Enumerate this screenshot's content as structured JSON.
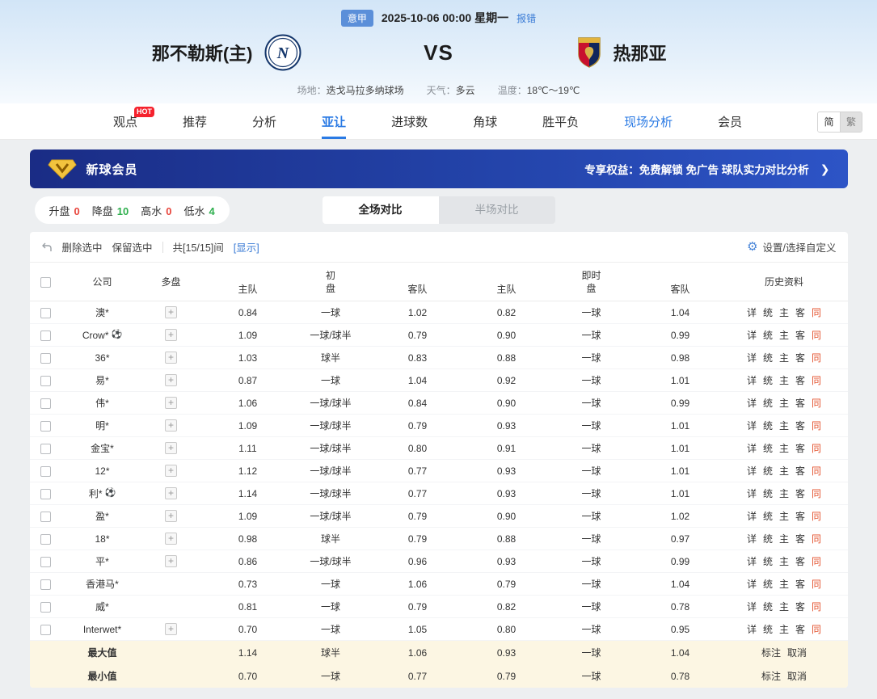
{
  "header": {
    "league_badge": "意甲",
    "datetime": "2025-10-06 00:00 星期一",
    "report_error": "报错",
    "home_team": "那不勒斯(主)",
    "home_logo_letter": "N",
    "vs": "VS",
    "away_team": "热那亚",
    "venue_label": "场地：",
    "venue": "迭戈马拉多纳球场",
    "weather_label": "天气：",
    "weather": "多云",
    "temp_label": "温度：",
    "temperature": "18℃～19℃"
  },
  "nav": {
    "items": [
      {
        "id": "viewpoint",
        "label": "观点",
        "badge": "HOT"
      },
      {
        "id": "recommend",
        "label": "推荐"
      },
      {
        "id": "analysis",
        "label": "分析"
      },
      {
        "id": "asian-handicap",
        "label": "亚让",
        "active": true
      },
      {
        "id": "goals",
        "label": "进球数"
      },
      {
        "id": "corner",
        "label": "角球"
      },
      {
        "id": "win-draw-lose",
        "label": "胜平负"
      },
      {
        "id": "live-analysis",
        "label": "现场分析",
        "highlight": true
      },
      {
        "id": "member",
        "label": "会员"
      }
    ],
    "lang_simplified": "简",
    "lang_traditional": "繁"
  },
  "banner": {
    "title": "新球会员",
    "benefits": "专享权益：免费解锁 免广告 球队实力对比分析",
    "arrow": "❯"
  },
  "filters": {
    "stats": [
      {
        "id": "rise",
        "label": "升盘",
        "value": "0",
        "color": "#e8453c"
      },
      {
        "id": "fall",
        "label": "降盘",
        "value": "10",
        "color": "#2faf4e"
      },
      {
        "id": "high-water",
        "label": "高水",
        "value": "0",
        "color": "#e8453c"
      },
      {
        "id": "low-water",
        "label": "低水",
        "value": "4",
        "color": "#2faf4e"
      }
    ],
    "tabs": [
      {
        "id": "full-match",
        "label": "全场对比",
        "active": true
      },
      {
        "id": "half-match",
        "label": "半场对比",
        "active": false
      }
    ]
  },
  "toolbar": {
    "delete_selected": "删除选中",
    "keep_selected": "保留选中",
    "count_text": "共[15/15]间",
    "show_link": "[显示]",
    "settings": "设置/选择自定义"
  },
  "table": {
    "headers": {
      "company": "公司",
      "multi": "多盘",
      "initial_group": "初",
      "live_group": "即时",
      "pan": "盘",
      "home": "主队",
      "away": "客队",
      "history": "历史资料"
    },
    "history_links": [
      {
        "id": "detail",
        "label": "详"
      },
      {
        "id": "stats",
        "label": "统"
      },
      {
        "id": "home",
        "label": "主"
      },
      {
        "id": "away",
        "label": "客"
      },
      {
        "id": "same",
        "label": "同",
        "accent": true
      }
    ],
    "rows": [
      {
        "company": "澳*",
        "multi": true,
        "init_home": "0.84",
        "init_pan": "一球",
        "init_away": "1.02",
        "live_home": "0.82",
        "live_pan": "一球",
        "live_away": "1.04"
      },
      {
        "company": "Crow*",
        "ball": true,
        "multi": true,
        "init_home": "1.09",
        "init_pan": "一球/球半",
        "init_away": "0.79",
        "live_home": "0.90",
        "live_pan": "一球",
        "live_away": "0.99"
      },
      {
        "company": "36*",
        "multi": true,
        "init_home": "1.03",
        "init_pan": "球半",
        "init_away": "0.83",
        "live_home": "0.88",
        "live_pan": "一球",
        "live_away": "0.98"
      },
      {
        "company": "易*",
        "multi": true,
        "init_home": "0.87",
        "init_pan": "一球",
        "init_away": "1.04",
        "live_home": "0.92",
        "live_pan": "一球",
        "live_away": "1.01"
      },
      {
        "company": "伟*",
        "multi": true,
        "init_home": "1.06",
        "init_pan": "一球/球半",
        "init_away": "0.84",
        "live_home": "0.90",
        "live_pan": "一球",
        "live_away": "0.99"
      },
      {
        "company": "明*",
        "multi": true,
        "init_home": "1.09",
        "init_pan": "一球/球半",
        "init_away": "0.79",
        "live_home": "0.93",
        "live_pan": "一球",
        "live_away": "1.01"
      },
      {
        "company": "金宝*",
        "multi": true,
        "init_home": "1.11",
        "init_pan": "一球/球半",
        "init_away": "0.80",
        "live_home": "0.91",
        "live_pan": "一球",
        "live_away": "1.01"
      },
      {
        "company": "12*",
        "multi": true,
        "init_home": "1.12",
        "init_pan": "一球/球半",
        "init_away": "0.77",
        "live_home": "0.93",
        "live_pan": "一球",
        "live_away": "1.01"
      },
      {
        "company": "利*",
        "ball": true,
        "multi": true,
        "init_home": "1.14",
        "init_pan": "一球/球半",
        "init_away": "0.77",
        "live_home": "0.93",
        "live_pan": "一球",
        "live_away": "1.01"
      },
      {
        "company": "盈*",
        "multi": true,
        "init_home": "1.09",
        "init_pan": "一球/球半",
        "init_away": "0.79",
        "live_home": "0.90",
        "live_pan": "一球",
        "live_away": "1.02"
      },
      {
        "company": "18*",
        "multi": true,
        "init_home": "0.98",
        "init_pan": "球半",
        "init_away": "0.79",
        "live_home": "0.88",
        "live_pan": "一球",
        "live_away": "0.97"
      },
      {
        "company": "平*",
        "multi": true,
        "init_home": "0.86",
        "init_pan": "一球/球半",
        "init_away": "0.96",
        "live_home": "0.93",
        "live_pan": "一球",
        "live_away": "0.99"
      },
      {
        "company": "香港马*",
        "multi": false,
        "init_home": "0.73",
        "init_pan": "一球",
        "init_away": "1.06",
        "live_home": "0.79",
        "live_pan": "一球",
        "live_away": "1.04"
      },
      {
        "company": "威*",
        "multi": false,
        "init_home": "0.81",
        "init_pan": "一球",
        "init_away": "0.79",
        "live_home": "0.82",
        "live_pan": "一球",
        "live_away": "0.78"
      },
      {
        "company": "Interwet*",
        "multi": true,
        "init_home": "0.70",
        "init_pan": "一球",
        "init_away": "1.05",
        "live_home": "0.80",
        "live_pan": "一球",
        "live_away": "0.95"
      }
    ],
    "summary": [
      {
        "label": "最大值",
        "init_home": "1.14",
        "init_pan": "球半",
        "init_away": "1.06",
        "live_home": "0.93",
        "live_pan": "一球",
        "live_away": "1.04"
      },
      {
        "label": "最小值",
        "init_home": "0.70",
        "init_pan": "一球",
        "init_away": "0.77",
        "live_home": "0.79",
        "live_pan": "一球",
        "live_away": "0.78"
      }
    ],
    "summary_actions": [
      {
        "id": "mark",
        "label": "标注"
      },
      {
        "id": "cancel",
        "label": "取消"
      }
    ]
  }
}
